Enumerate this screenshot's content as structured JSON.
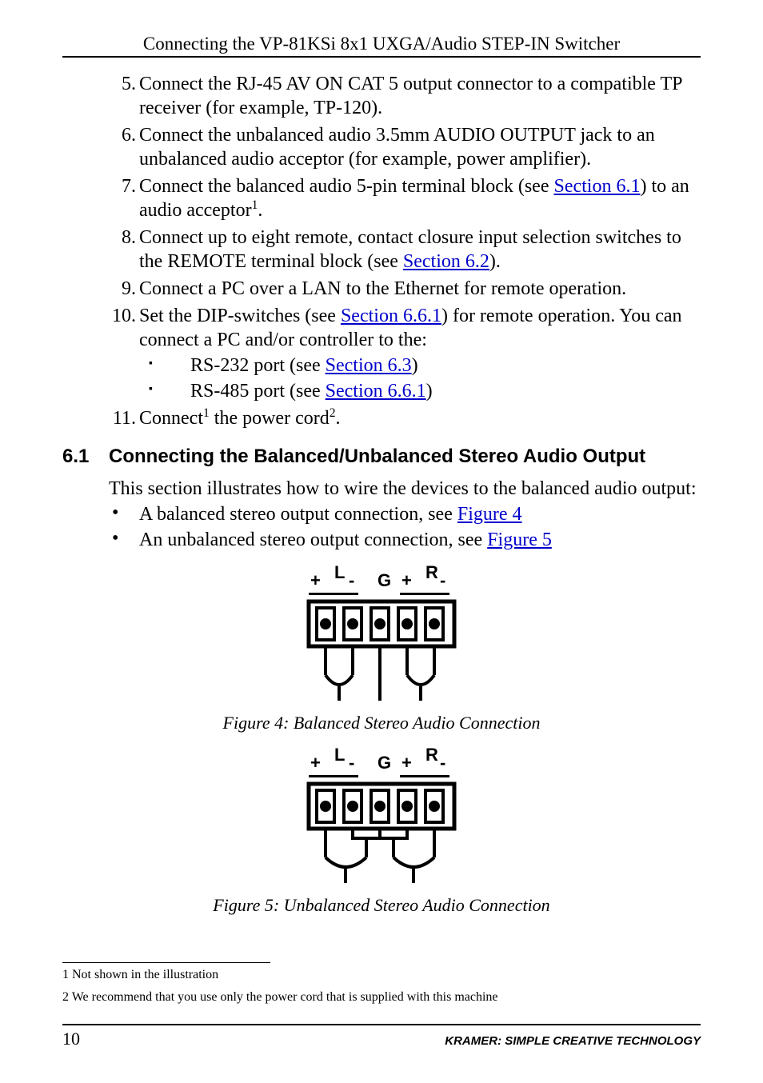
{
  "running_head": "Connecting the VP-81KSi 8x1 UXGA/Audio STEP-IN Switcher",
  "list": {
    "i5": {
      "num": "5.",
      "text_a": "Connect the RJ-45 AV ON CAT 5 output connector to a compatible TP receiver (for example, TP-120)."
    },
    "i6": {
      "num": "6.",
      "text_a": "Connect the unbalanced audio 3.5mm AUDIO OUTPUT jack to an unbalanced audio acceptor (for example, power amplifier)."
    },
    "i7": {
      "num": "7.",
      "text_a": "Connect the balanced audio 5-pin terminal block (see ",
      "link": "Section 6.1",
      "text_b": ") to an audio acceptor",
      "sup": "1",
      "text_c": "."
    },
    "i8": {
      "num": "8.",
      "text_a": "Connect up to eight remote, contact closure input selection switches to the REMOTE terminal block (see ",
      "link": "Section 6.2",
      "text_b": ")."
    },
    "i9": {
      "num": "9.",
      "text_a": "Connect a PC over a LAN to the Ethernet for remote operation."
    },
    "i10": {
      "num": "10.",
      "text_a": "Set the DIP-switches (see ",
      "link": "Section 6.6.1",
      "text_b": ") for remote operation. You can connect a PC and/or controller to the:",
      "sub1_a": "RS-232 port (see ",
      "sub1_link": "Section 6.3",
      "sub1_b": ")",
      "sub2_a": "RS-485 port (see ",
      "sub2_link": "Section 6.6.1",
      "sub2_b": ")"
    },
    "i11": {
      "num": "11.",
      "text_a": "Connect",
      "sup1": "1",
      "text_b": " the power cord",
      "sup2": "2",
      "text_c": "."
    }
  },
  "section": {
    "num": "6.1",
    "title": "Connecting the Balanced/Unbalanced Stereo Audio Output",
    "intro": "This section illustrates how to wire the devices to the balanced audio output:",
    "b1_a": "A balanced stereo output connection, see ",
    "b1_link": "Figure 4",
    "b2_a": "An unbalanced stereo output connection, see ",
    "b2_link": "Figure 5"
  },
  "conn_labels": {
    "plus": "+",
    "minus": "-",
    "L": "L",
    "R": "R",
    "G": "G"
  },
  "fig4_caption": "Figure 4: Balanced Stereo Audio Connection",
  "fig5_caption": "Figure 5: Unbalanced Stereo Audio Connection",
  "footnotes": {
    "f1": "1 Not shown in the illustration",
    "f2": "2 We recommend that you use only the power cord that is supplied with this machine"
  },
  "footer": {
    "page": "10",
    "brand": "KRAMER:  SIMPLE CREATIVE TECHNOLOGY"
  }
}
